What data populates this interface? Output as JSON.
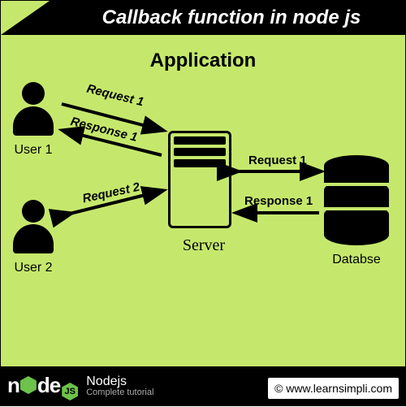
{
  "header": {
    "title": "Callback function in node js"
  },
  "main": {
    "title": "Application"
  },
  "users": {
    "user1_label": "User 1",
    "user2_label": "User 2"
  },
  "server": {
    "label": "Server"
  },
  "database": {
    "label": "Databse"
  },
  "arrows": {
    "u1_request": "Request 1",
    "u1_response": "Response 1",
    "u2_request": "Request 2",
    "db_request": "Request 1",
    "db_response": "Response 1"
  },
  "footer": {
    "logo_text": "n   de",
    "hex_text": "JS",
    "title": "Nodejs",
    "subtitle": "Complete tutorial",
    "copyright": "© www.learnsimpli.com"
  },
  "chart_data": {
    "type": "diagram",
    "title": "Callback function in node js",
    "subtitle": "Application",
    "nodes": [
      {
        "id": "user1",
        "label": "User 1",
        "type": "user"
      },
      {
        "id": "user2",
        "label": "User 2",
        "type": "user"
      },
      {
        "id": "server",
        "label": "Server",
        "type": "server"
      },
      {
        "id": "database",
        "label": "Databse",
        "type": "database"
      }
    ],
    "edges": [
      {
        "from": "user1",
        "to": "server",
        "label": "Request 1",
        "direction": "forward"
      },
      {
        "from": "server",
        "to": "user1",
        "label": "Response 1",
        "direction": "back"
      },
      {
        "from": "user2",
        "to": "server",
        "label": "Request 2",
        "direction": "bidirectional"
      },
      {
        "from": "server",
        "to": "database",
        "label": "Request 1",
        "direction": "bidirectional"
      },
      {
        "from": "database",
        "to": "server",
        "label": "Response 1",
        "direction": "back"
      }
    ]
  }
}
